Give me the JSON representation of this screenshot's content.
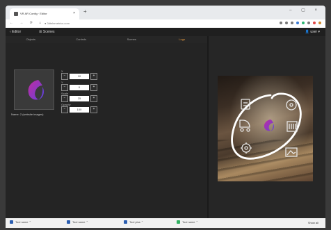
{
  "browser": {
    "tab_title": "VR AR Config · Editor",
    "tab_close": "×",
    "new_tab": "+",
    "window_controls": "– ▢ ×",
    "nav_icons": "← → ⟳ ⌂",
    "url": "● 3dtelemetrics.com"
  },
  "app": {
    "back_label": "‹ Editor",
    "section_label": "☰ Scenes",
    "user_label": "👤 user ▾",
    "tabs": [
      {
        "label": "Objects",
        "active": false
      },
      {
        "label": "Controls",
        "active": false
      },
      {
        "label": "Scenes",
        "active": false
      },
      {
        "label": "Logo",
        "active": true
      }
    ],
    "thumbnail_caption": "Name: 2 (website images)",
    "fields": [
      {
        "label": "X",
        "value": "10"
      },
      {
        "label": "Y",
        "value": "0"
      },
      {
        "label": "Scale",
        "value": "25"
      },
      {
        "label": "Opacity",
        "value": "100"
      }
    ],
    "stepper_minus": "−",
    "stepper_plus": "+"
  },
  "downloads": [
    {
      "name": "Tool name"
    },
    {
      "name": "Tool name"
    },
    {
      "name": "Tool plus"
    },
    {
      "name": "Tool name"
    }
  ],
  "show_all": "Show all",
  "colors": {
    "accent": "#f0a040",
    "logo_start": "#c02ca0",
    "logo_end": "#6a3fd8"
  }
}
